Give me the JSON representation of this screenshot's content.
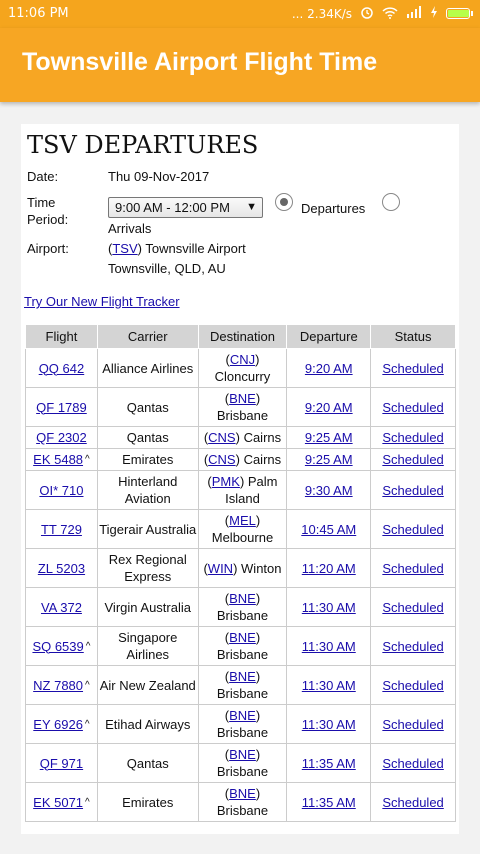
{
  "status_bar": {
    "time": "11:06 PM",
    "network_speed": "... 2.34K/s",
    "battery_level": 0.95
  },
  "app_bar": {
    "title": "Townsville Airport Flight Time"
  },
  "page": {
    "heading": "TSV DEPARTURES",
    "date_label": "Date:",
    "date_value": "Thu 09-Nov-2017",
    "time_period_label_1": "Time",
    "time_period_label_2": "Period:",
    "time_period_selected": "9:00 AM - 12:00 PM",
    "radio_departures": "Departures",
    "radio_arrivals": "Arrivals",
    "airport_label": "Airport:",
    "airport_code": "TSV",
    "airport_name": "Townsville Airport",
    "airport_location": "Townsville, QLD, AU",
    "tracker_link": "Try Our New Flight Tracker"
  },
  "table": {
    "headers": [
      "Flight",
      "Carrier",
      "Destination",
      "Departure",
      "Status"
    ],
    "rows": [
      {
        "flight": "QQ 642",
        "codeshare": false,
        "carrier": "Alliance Airlines",
        "dest_code": "CNJ",
        "dest_name": "Cloncurry",
        "dest_wrap": true,
        "departure": "9:20 AM",
        "status": "Scheduled"
      },
      {
        "flight": "QF 1789",
        "codeshare": false,
        "carrier": "Qantas",
        "dest_code": "BNE",
        "dest_name": "Brisbane",
        "dest_wrap": true,
        "departure": "9:20 AM",
        "status": "Scheduled"
      },
      {
        "flight": "QF 2302",
        "codeshare": false,
        "carrier": "Qantas",
        "dest_code": "CNS",
        "dest_name": "Cairns",
        "dest_wrap": false,
        "departure": "9:25 AM",
        "status": "Scheduled"
      },
      {
        "flight": "EK 5488",
        "codeshare": true,
        "carrier": "Emirates",
        "dest_code": "CNS",
        "dest_name": "Cairns",
        "dest_wrap": false,
        "departure": "9:25 AM",
        "status": "Scheduled"
      },
      {
        "flight": "OI* 710",
        "codeshare": false,
        "carrier": "Hinterland Aviation",
        "dest_code": "PMK",
        "dest_name": "Palm Island",
        "dest_wrap": false,
        "departure": "9:30 AM",
        "status": "Scheduled"
      },
      {
        "flight": "TT 729",
        "codeshare": false,
        "carrier": "Tigerair Australia",
        "dest_code": "MEL",
        "dest_name": "Melbourne",
        "dest_wrap": true,
        "departure": "10:45 AM",
        "status": "Scheduled"
      },
      {
        "flight": "ZL 5203",
        "codeshare": false,
        "carrier": "Rex Regional Express",
        "dest_code": "WIN",
        "dest_name": "Winton",
        "dest_wrap": false,
        "departure": "11:20 AM",
        "status": "Scheduled"
      },
      {
        "flight": "VA 372",
        "codeshare": false,
        "carrier": "Virgin Australia",
        "dest_code": "BNE",
        "dest_name": "Brisbane",
        "dest_wrap": true,
        "departure": "11:30 AM",
        "status": "Scheduled"
      },
      {
        "flight": "SQ 6539",
        "codeshare": true,
        "carrier": "Singapore Airlines",
        "dest_code": "BNE",
        "dest_name": "Brisbane",
        "dest_wrap": true,
        "departure": "11:30 AM",
        "status": "Scheduled"
      },
      {
        "flight": "NZ 7880",
        "codeshare": true,
        "carrier": "Air New Zealand",
        "dest_code": "BNE",
        "dest_name": "Brisbane",
        "dest_wrap": true,
        "departure": "11:30 AM",
        "status": "Scheduled"
      },
      {
        "flight": "EY 6926",
        "codeshare": true,
        "carrier": "Etihad Airways",
        "dest_code": "BNE",
        "dest_name": "Brisbane",
        "dest_wrap": true,
        "departure": "11:30 AM",
        "status": "Scheduled"
      },
      {
        "flight": "QF 971",
        "codeshare": false,
        "carrier": "Qantas",
        "dest_code": "BNE",
        "dest_name": "Brisbane",
        "dest_wrap": true,
        "departure": "11:35 AM",
        "status": "Scheduled"
      },
      {
        "flight": "EK 5071",
        "codeshare": true,
        "carrier": "Emirates",
        "dest_code": "BNE",
        "dest_name": "Brisbane",
        "dest_wrap": true,
        "departure": "11:35 AM",
        "status": "Scheduled"
      }
    ]
  },
  "colors": {
    "app_bar": "#f7a623",
    "status_bar": "#f5a51d",
    "link": "#1a0dab",
    "header_bg": "#d4d4d4"
  },
  "icons": [
    "signal-dots-icon",
    "alarm-icon",
    "wifi-icon",
    "cell-signal-icon",
    "charging-icon",
    "battery-icon",
    "dropdown-arrow-icon"
  ]
}
